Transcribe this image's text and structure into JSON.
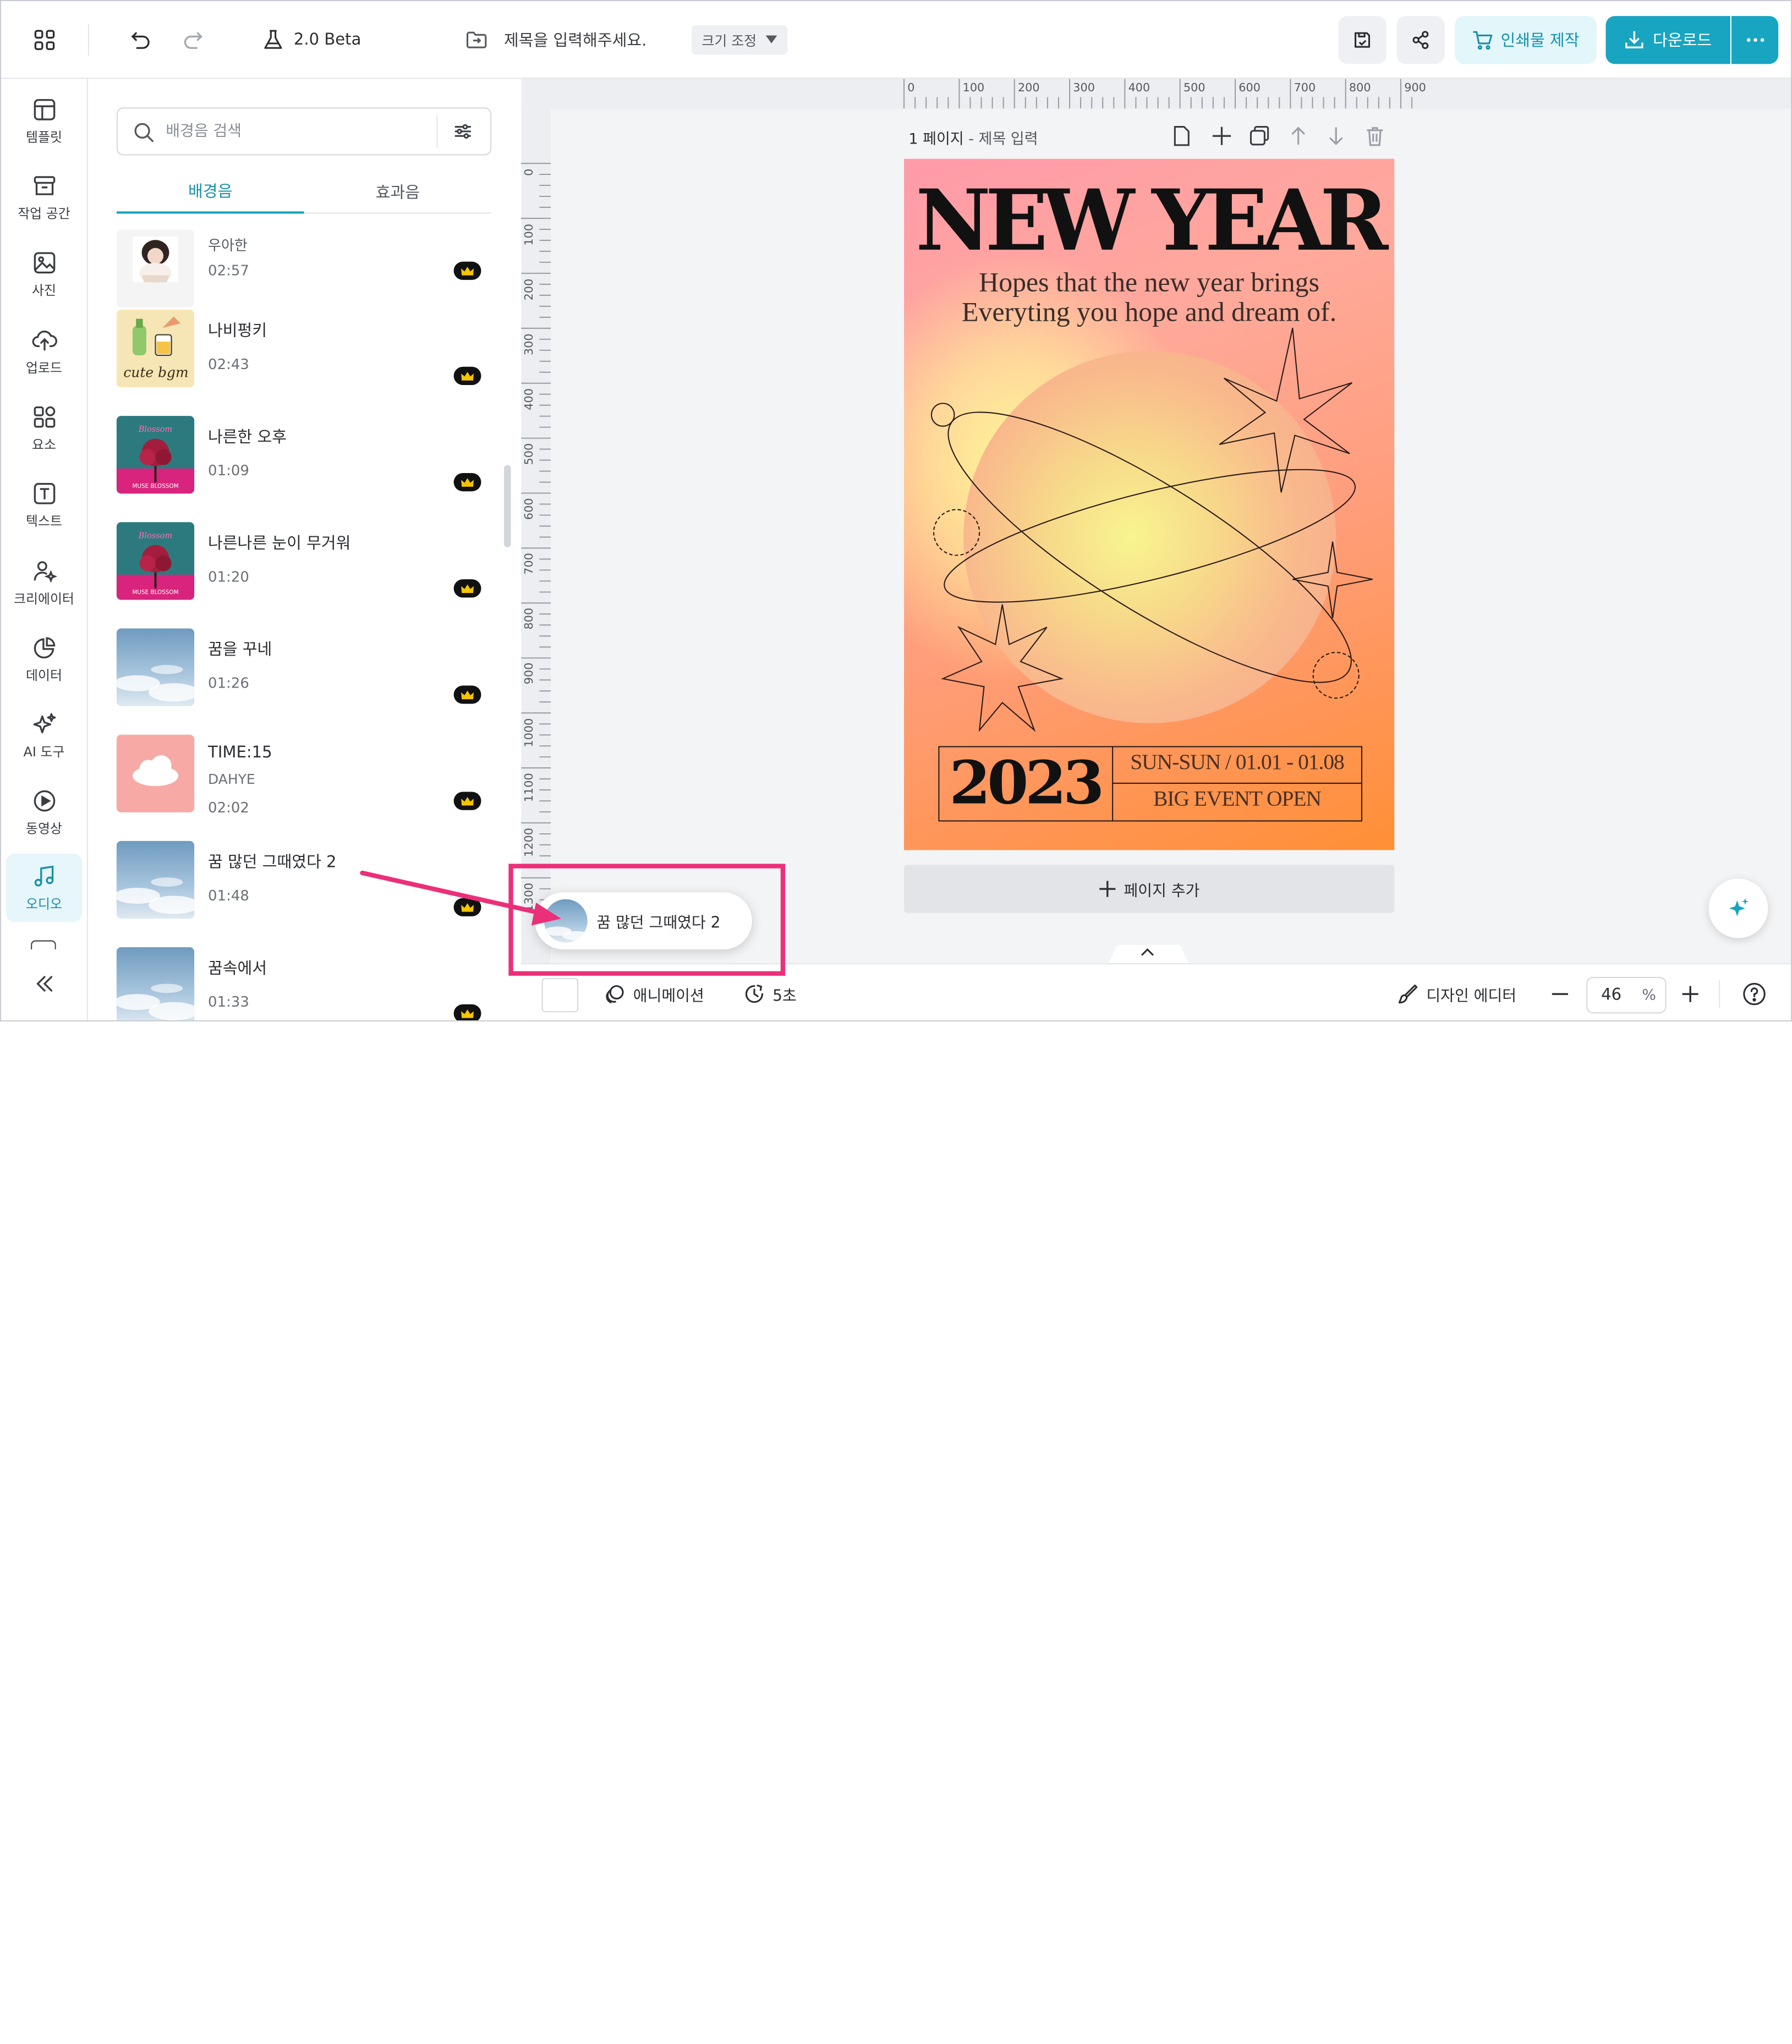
{
  "topbar": {
    "version_label": "2.0 Beta",
    "title_placeholder": "제목을 입력해주세요.",
    "resize_label": "크기 조정",
    "print_label": "인쇄물 제작",
    "download_label": "다운로드"
  },
  "rail": {
    "items": [
      {
        "label": "템플릿",
        "icon": "template-icon"
      },
      {
        "label": "작업 공간",
        "icon": "archive-icon"
      },
      {
        "label": "사진",
        "icon": "photo-icon"
      },
      {
        "label": "업로드",
        "icon": "cloud-upload-icon"
      },
      {
        "label": "요소",
        "icon": "shapes-icon"
      },
      {
        "label": "텍스트",
        "icon": "text-icon"
      },
      {
        "label": "크리에이터",
        "icon": "creator-icon"
      },
      {
        "label": "데이터",
        "icon": "chart-icon"
      },
      {
        "label": "AI 도구",
        "icon": "sparkle-icon"
      },
      {
        "label": "동영상",
        "icon": "play-icon"
      },
      {
        "label": "오디오",
        "icon": "music-icon"
      }
    ]
  },
  "panel": {
    "search_placeholder": "배경음 검색",
    "tabs": [
      {
        "label": "배경음"
      },
      {
        "label": "효과음"
      }
    ],
    "tracks": [
      {
        "title": "우아한",
        "duration": "02:57"
      },
      {
        "title": "나비펑키",
        "duration": "02:43",
        "thumb_text": "cute bgm"
      },
      {
        "title": "나른한 오후",
        "duration": "01:09",
        "thumb_text": "MUSE BLOSSOM"
      },
      {
        "title": "나른나른 눈이 무거워",
        "duration": "01:20",
        "thumb_text": "MUSE BLOSSOM"
      },
      {
        "title": "꿈을 꾸네",
        "duration": "01:26"
      },
      {
        "title": "TIME:15",
        "artist": "DAHYE",
        "duration": "02:02"
      },
      {
        "title": "꿈 많던 그때였다 2",
        "duration": "01:48"
      },
      {
        "title": "꿈속에서",
        "duration": "01:33"
      }
    ]
  },
  "canvas": {
    "page_number": "1 페이지",
    "page_sep": " - ",
    "page_title_placeholder": "제목 입력",
    "ruler_h": [
      "0",
      "100",
      "200",
      "300",
      "400",
      "500",
      "600",
      "700",
      "800",
      "900"
    ],
    "ruler_v": [
      "0",
      "100",
      "200",
      "300",
      "400",
      "500",
      "600",
      "700",
      "800",
      "900",
      "1000",
      "1100",
      "1200",
      "1300"
    ],
    "add_page_label": "페이지 추가"
  },
  "poster": {
    "headline": "NEW YEAR",
    "tagline_1": "Hopes that the new year brings",
    "tagline_2": "Everyting you hope and dream of.",
    "year": "2023",
    "dates": "SUN-SUN / 01.01 - 01.08",
    "event": "BIG EVENT OPEN"
  },
  "drag_chip": {
    "label": "꿈 많던 그때였다 2"
  },
  "bottombar": {
    "animation_label": "애니메이션",
    "duration_label": "5초",
    "design_editor_label": "디자인 에디터",
    "zoom_value": "46",
    "zoom_unit": "%"
  },
  "colors": {
    "accent": "#17a5c1",
    "highlight": "#ec2f79"
  }
}
